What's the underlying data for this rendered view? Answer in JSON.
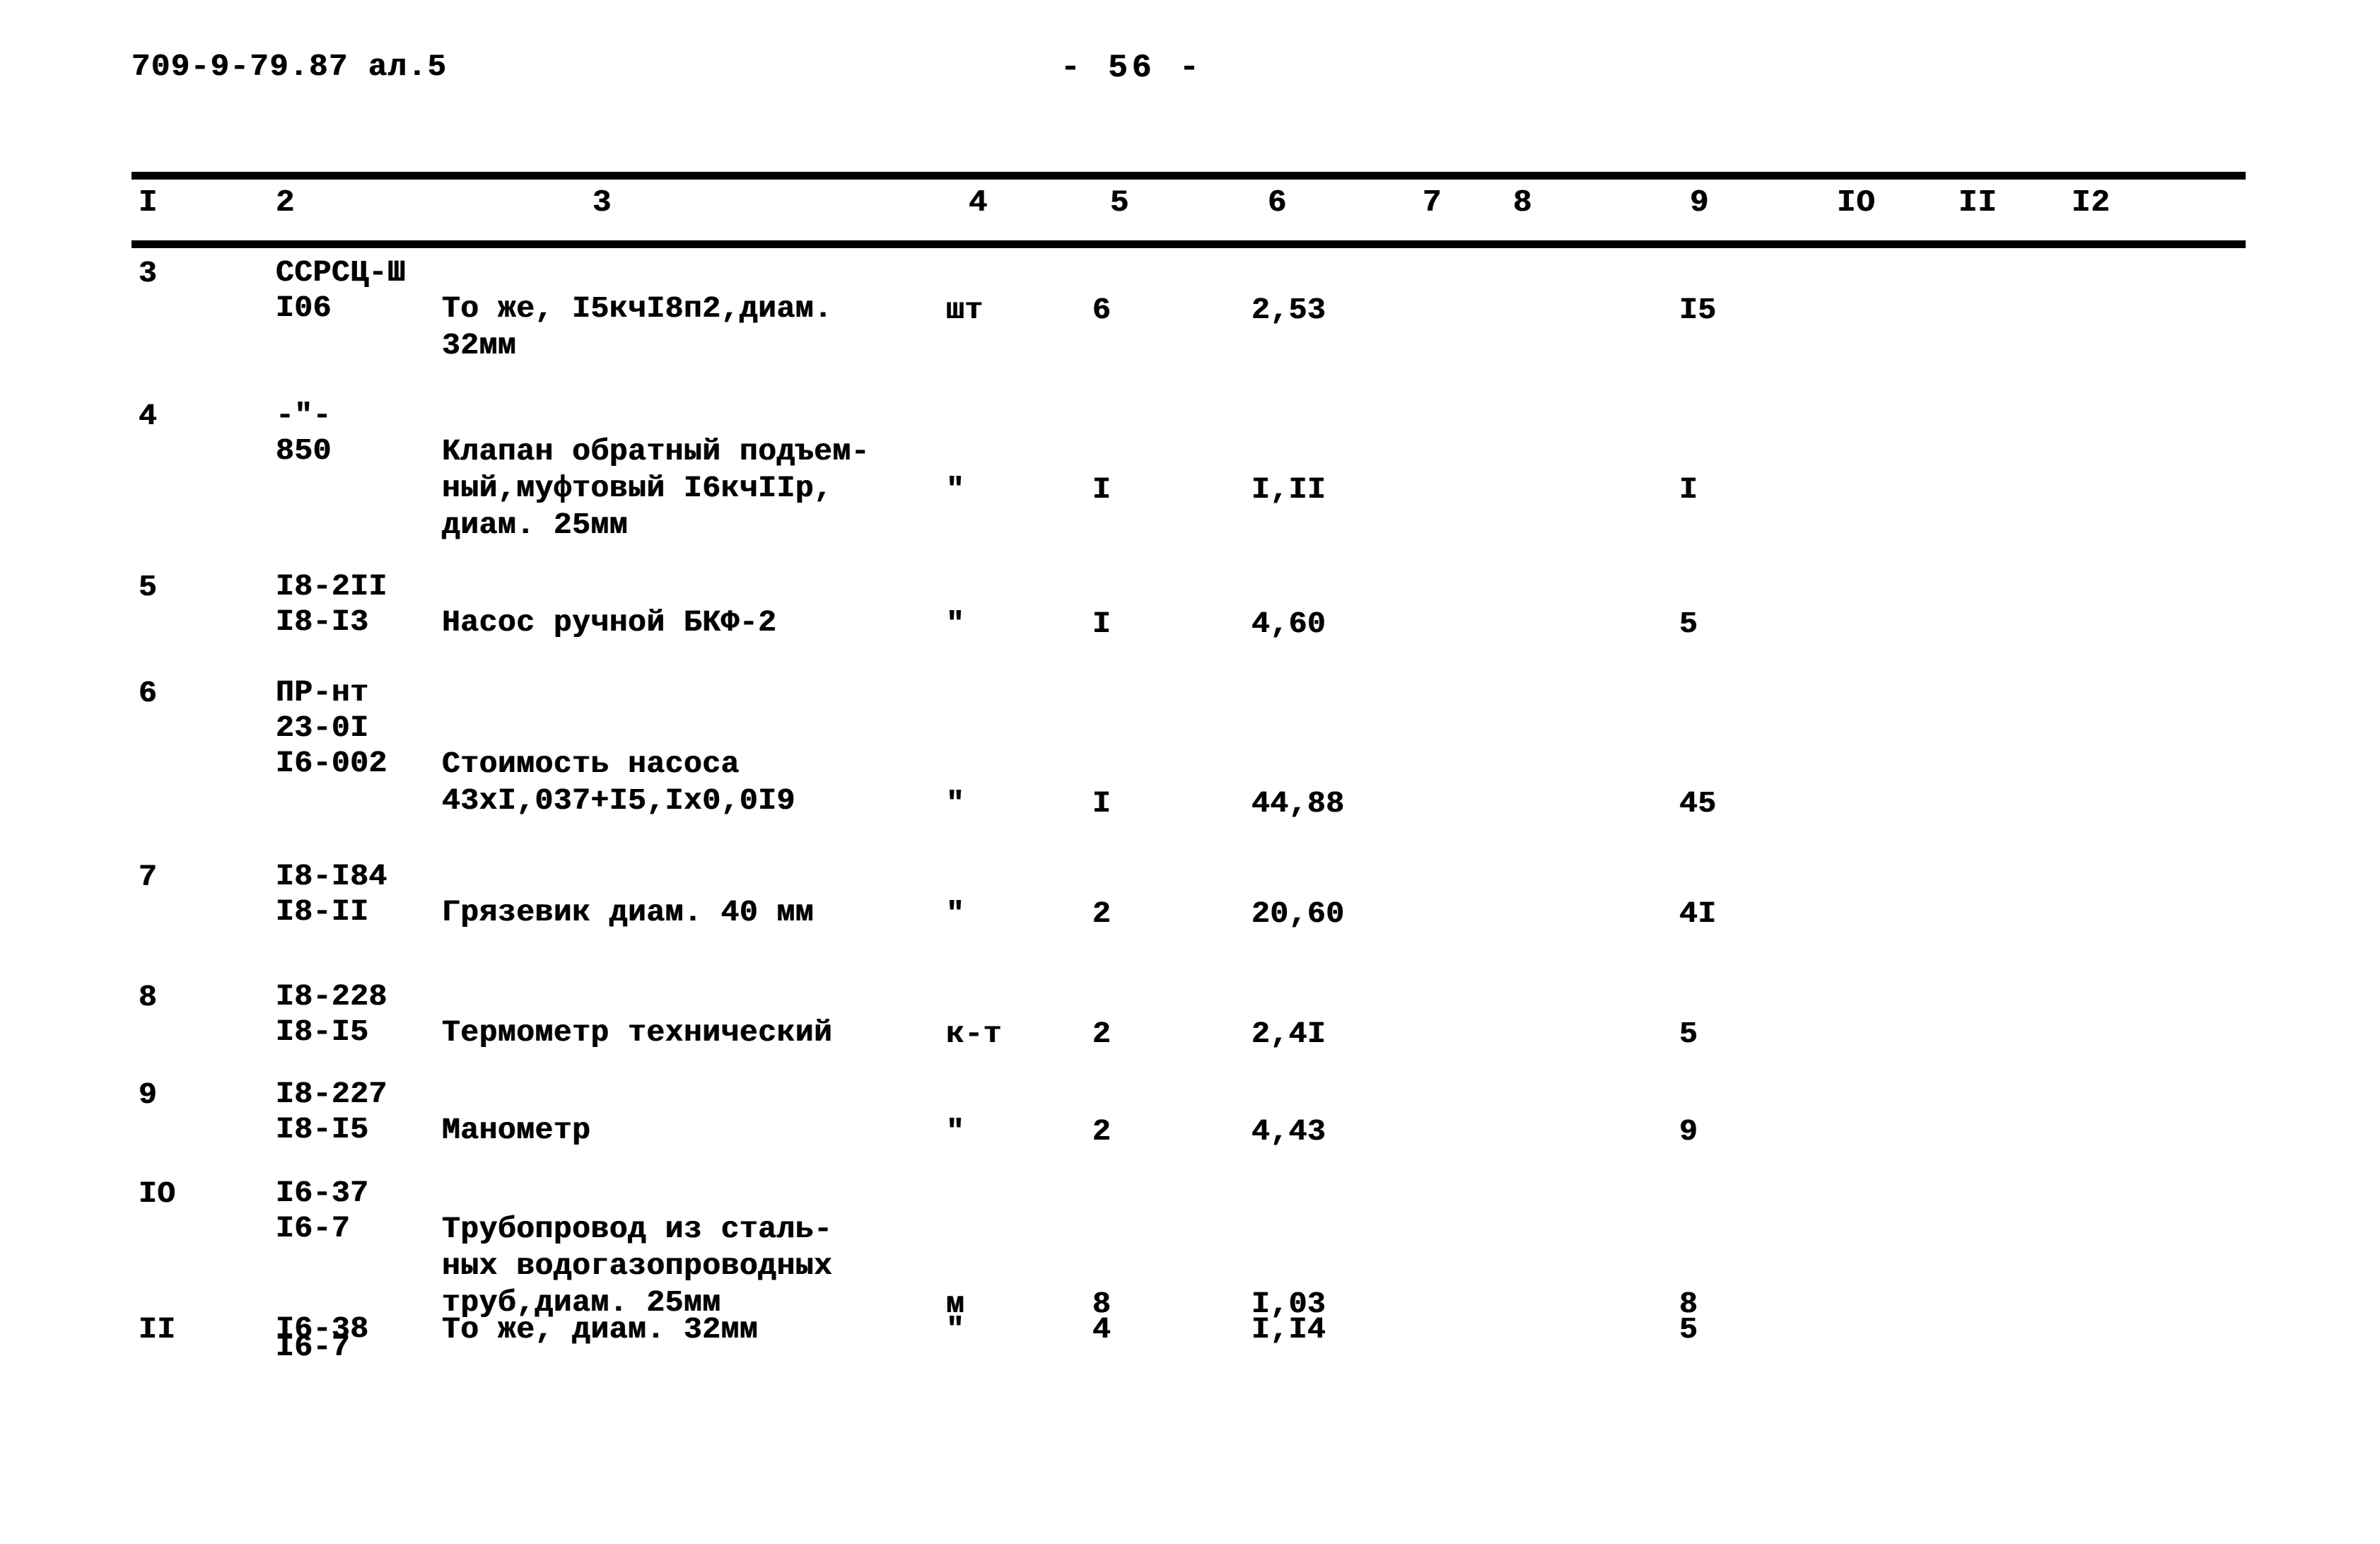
{
  "header": {
    "doc_code": "709-9-79.87 ал.5",
    "page_label": "-  56  -"
  },
  "table": {
    "column_headers": [
      "I",
      "2",
      "3",
      "4",
      "5",
      "6",
      "7",
      "8",
      "9",
      "IO",
      "II",
      "I2"
    ],
    "rows": [
      {
        "no": "3",
        "codes": [
          "ССРСЦ-Ш",
          "I06"
        ],
        "description": [
          "То же, I5кчI8п2,диам.",
          "32мм"
        ],
        "unit": "шт",
        "qty": "6",
        "price": "2,53",
        "col7": "",
        "col8": "",
        "col9": "I5",
        "col10": "",
        "col11": "",
        "col12": ""
      },
      {
        "no": "4",
        "codes": [
          "-\"-",
          "850"
        ],
        "description": [
          "Клапан обратный подъем-",
          "ный,муфтовый I6кчIIр,",
          "диам. 25мм"
        ],
        "unit": "\"",
        "qty": "I",
        "price": "I,II",
        "col7": "",
        "col8": "",
        "col9": "I",
        "col10": "",
        "col11": "",
        "col12": ""
      },
      {
        "no": "5",
        "codes": [
          "I8-2II",
          "I8-I3"
        ],
        "description": [
          "Насос ручной БКФ-2"
        ],
        "unit": "\"",
        "qty": "I",
        "price": "4,60",
        "col7": "",
        "col8": "",
        "col9": "5",
        "col10": "",
        "col11": "",
        "col12": ""
      },
      {
        "no": "6",
        "codes": [
          "ПР-нт",
          "23-0I",
          "I6-002"
        ],
        "description": [
          "Стоимость насоса",
          "43хI,037+I5,Iх0,0I9"
        ],
        "unit": "\"",
        "qty": "I",
        "price": "44,88",
        "col7": "",
        "col8": "",
        "col9": "45",
        "col10": "",
        "col11": "",
        "col12": ""
      },
      {
        "no": "7",
        "codes": [
          "I8-I84",
          "I8-II"
        ],
        "description": [
          "Грязевик диам. 40 мм"
        ],
        "unit": "\"",
        "qty": "2",
        "price": "20,60",
        "col7": "",
        "col8": "",
        "col9": "4I",
        "col10": "",
        "col11": "",
        "col12": ""
      },
      {
        "no": "8",
        "codes": [
          "I8-228",
          "I8-I5"
        ],
        "description": [
          "Термометр технический"
        ],
        "unit": "к-т",
        "qty": "2",
        "price": "2,4I",
        "col7": "",
        "col8": "",
        "col9": "5",
        "col10": "",
        "col11": "",
        "col12": ""
      },
      {
        "no": "9",
        "codes": [
          "I8-227",
          "I8-I5"
        ],
        "description": [
          "Манометр"
        ],
        "unit": "\"",
        "qty": "2",
        "price": "4,43",
        "col7": "",
        "col8": "",
        "col9": "9",
        "col10": "",
        "col11": "",
        "col12": ""
      },
      {
        "no": "IO",
        "codes": [
          "I6-37",
          "I6-7"
        ],
        "description": [
          "Трубопровод из сталь-",
          "ных водогазопроводных",
          "труб,диам. 25мм"
        ],
        "unit": "м",
        "qty": "8",
        "price": "I,03",
        "col7": "",
        "col8": "",
        "col9": "8",
        "col10": "",
        "col11": "",
        "col12": ""
      },
      {
        "no": "II",
        "codes": [
          "I6-38",
          "I6-7"
        ],
        "description": [
          "То же, диам. 32мм"
        ],
        "unit": "\"",
        "qty": "4",
        "price": "I,I4",
        "col7": "",
        "col8": "",
        "col9": "5",
        "col10": "",
        "col11": "",
        "col12": ""
      }
    ]
  }
}
